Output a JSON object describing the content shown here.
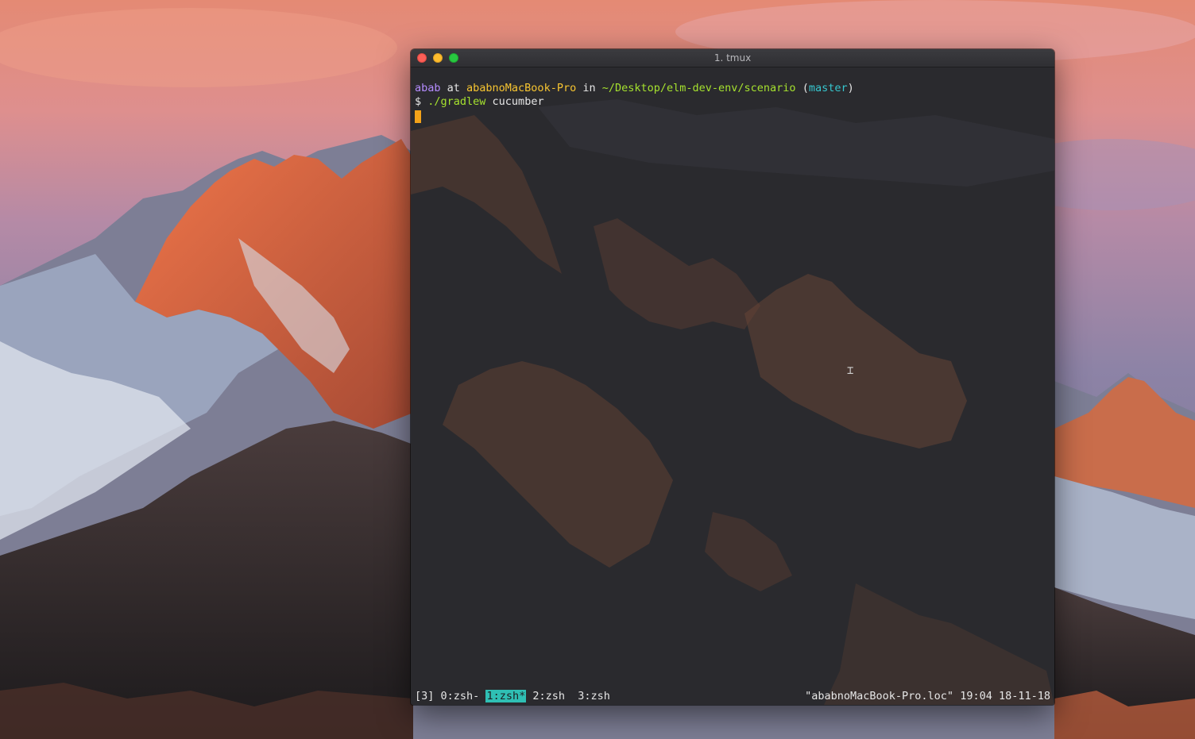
{
  "window": {
    "title": "1. tmux"
  },
  "terminal": {
    "prompt": {
      "user": "abab",
      "at": " at ",
      "host": "ababnoMacBook-Pro",
      "in": " in ",
      "path": "~/Desktop/elm-dev-env/scenario",
      "branch_open": " (",
      "branch": "master",
      "branch_close": ")"
    },
    "command": {
      "symbol": "$ ",
      "executable": "./gradlew",
      "args": " cucumber"
    },
    "cursor_color": "#f3a219"
  },
  "status_bar": {
    "session_count": "[3]",
    "windows": [
      {
        "label": "0:zsh-",
        "active": false
      },
      {
        "label": "1:zsh*",
        "active": true
      },
      {
        "label": "2:zsh",
        "active": false
      },
      {
        "label": "3:zsh",
        "active": false
      }
    ],
    "host": "\"ababnoMacBook-Pro.loc\"",
    "time": "19:04",
    "date": "18-11-18",
    "active_color": "#2fbfb4"
  },
  "colors": {
    "user": "#b58cff",
    "host": "#f7c531",
    "path": "#a6e22e",
    "branch": "#36c7cf"
  },
  "icons": {
    "close": "close-icon",
    "minimize": "minimize-icon",
    "zoom": "zoom-icon",
    "mouse_cursor": "ibeam-cursor-icon"
  }
}
